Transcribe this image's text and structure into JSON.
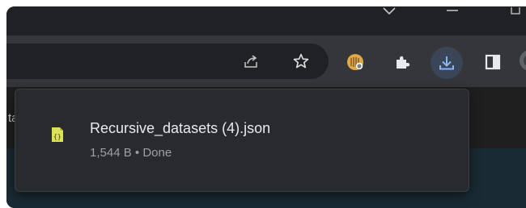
{
  "download_popup": {
    "filename": "Recursive_datasets (4).json",
    "size": "1,544 B",
    "separator": "•",
    "state": "Done"
  },
  "page": {
    "visible_fragment": "ta"
  },
  "icons": {
    "window_controls": [
      "chevron-down-icon",
      "minimize-icon",
      "restore-icon"
    ],
    "omnibox": [
      "share-icon",
      "bookmark-star-icon"
    ],
    "toolbar": [
      "extension-avatar-icon",
      "extensions-puzzle-icon",
      "download-icon",
      "side-panel-icon",
      "profile-icon"
    ]
  },
  "colors": {
    "titlebar": "#202124",
    "toolbar": "#35363a",
    "popup_bg": "#292a2d",
    "download_active_bg": "#3a4658",
    "download_accent": "#8ab4f8",
    "text_primary": "#e8eaed",
    "text_secondary": "#9aa0a6",
    "file_icon_yellow": "#d9e25a"
  }
}
